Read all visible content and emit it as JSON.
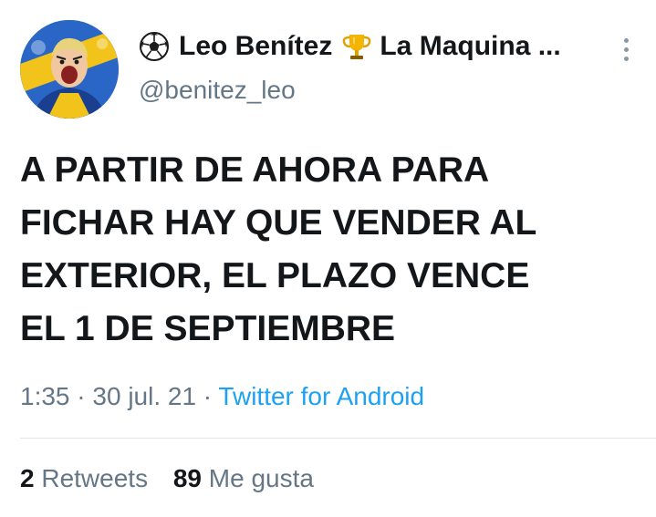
{
  "tweet": {
    "author": {
      "display_name_prefix_icon": "soccer-ball-icon",
      "display_name": "Leo Benítez",
      "display_name_mid_icon": "trophy-icon",
      "display_name_suffix": "La Maquina ...",
      "handle": "@benitez_leo"
    },
    "text_lines": [
      "A PARTIR DE AHORA PARA",
      "FICHAR HAY QUE VENDER AL",
      "EXTERIOR, EL PLAZO VENCE",
      "EL 1 DE SEPTIEMBRE"
    ],
    "meta": {
      "time": "1:35",
      "separator": " · ",
      "date": "30 jul. 21",
      "source": "Twitter for Android"
    },
    "stats": {
      "retweets_count": "2",
      "retweets_label": "Retweets",
      "likes_count": "89",
      "likes_label": "Me gusta"
    },
    "colors": {
      "text": "#14171a",
      "secondary": "#657786",
      "link": "#1da1f2",
      "divider": "#e1e8ed"
    }
  }
}
